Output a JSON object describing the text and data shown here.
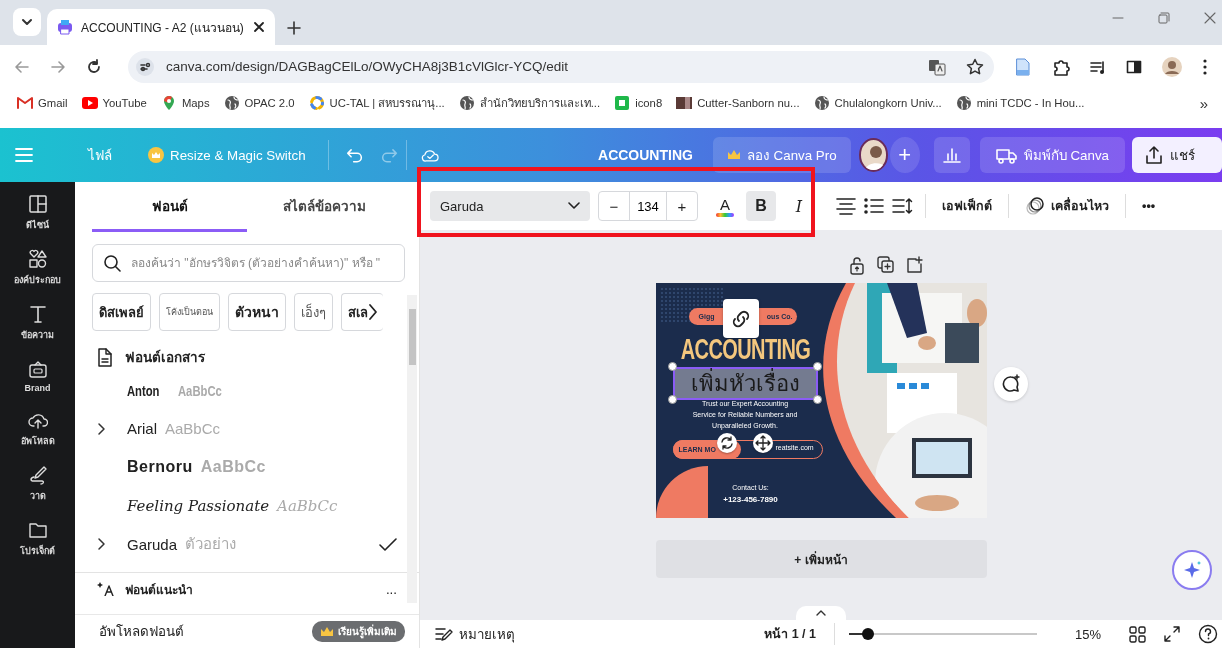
{
  "browser": {
    "tabs": [
      {
        "title": "ACCOUNTING - A2 (แนวนอน)",
        "selected": true
      }
    ],
    "url": "canva.com/design/DAGBagCElLo/OWyCHA8j3B1cVlGlcr-YCQ/edit",
    "bookmarks": [
      {
        "label": "Gmail",
        "kind": "mail"
      },
      {
        "label": "YouTube",
        "kind": "video"
      },
      {
        "label": "Maps",
        "kind": "pin"
      },
      {
        "label": "OPAC 2.0",
        "kind": "globe"
      },
      {
        "label": "UC-TAL | สหบรรณานุ...",
        "kind": "ring"
      },
      {
        "label": "สำนักวิทยบริการและเท...",
        "kind": "globe"
      },
      {
        "label": "icon8",
        "kind": "square"
      },
      {
        "label": "Cutter-Sanborn nu...",
        "kind": "thumb"
      },
      {
        "label": "Chulalongkorn Univ...",
        "kind": "globe"
      },
      {
        "label": "mini TCDC - In Hou...",
        "kind": "globe"
      }
    ],
    "more": "»"
  },
  "header": {
    "file": "ไฟล์",
    "resize": "Resize & Magic Switch",
    "title": "ACCOUNTING",
    "pro": "ลอง Canva Pro",
    "invite": "+",
    "print": "พิมพ์กับ Canva",
    "share": "แชร์"
  },
  "rail": [
    {
      "label": "ดีไซน์",
      "kind": "layout"
    },
    {
      "label": "องค์ประกอบ",
      "kind": "shapes"
    },
    {
      "label": "ข้อความ",
      "kind": "text"
    },
    {
      "label": "Brand",
      "kind": "brand"
    },
    {
      "label": "อัพโหลด",
      "kind": "upload"
    },
    {
      "label": "วาด",
      "kind": "draw"
    },
    {
      "label": "โปรเจ็กต์",
      "kind": "folder"
    }
  ],
  "panel": {
    "tabs": [
      {
        "label": "ฟอนต์",
        "selected": true
      },
      {
        "label": "สไตล์ข้อความ",
        "selected": false
      }
    ],
    "search_placeholder": "ลองค้นว่า \"อักษรวิจิตร (ตัวอย่างคำค้นหา)\" หรือ \"",
    "chips": [
      {
        "label": "ดิสเพลย์",
        "kind": "display"
      },
      {
        "label": "โค้งเป็นตอน",
        "kind": "thin"
      },
      {
        "label": "ตัวหนา",
        "kind": "bold"
      },
      {
        "label": "เอ็งๆ",
        "kind": "light"
      },
      {
        "label": "สเล",
        "kind": "plain"
      }
    ],
    "section": "ฟอนต์เอกสาร",
    "fonts": [
      {
        "name": "Anton",
        "sample": "AaBbCc",
        "kind": "condensed",
        "expandable": false,
        "checked": false
      },
      {
        "name": "Arial",
        "sample": "AaBbCc",
        "kind": "sans",
        "expandable": true,
        "checked": false
      },
      {
        "name": "Bernoru",
        "sample": "AaBbCc",
        "kind": "heavy",
        "expandable": false,
        "checked": false
      },
      {
        "name": "Feeling Passionate",
        "sample": "AaBbCc",
        "kind": "script",
        "expandable": false,
        "checked": false
      },
      {
        "name": "Garuda",
        "sample": "ตัวอย่าง",
        "kind": "sans",
        "expandable": true,
        "checked": true
      }
    ],
    "recommended": "ฟอนต์แนะนำ",
    "recommended_more": "...",
    "upload": "อัพโหลดฟอนต์",
    "learn": "เรียนรู้เพิ่มเติม"
  },
  "toolbar": {
    "font": "Garuda",
    "minus": "−",
    "size": "134",
    "plus": "+",
    "color_label": "A",
    "bold": {
      "label": "B",
      "selected": true
    },
    "italic": {
      "label": "I",
      "selected": false
    },
    "effects": "เอฟเฟ็กต์",
    "animate": "เคลื่อนไหว",
    "more": "•••"
  },
  "design": {
    "company_left": "Gigg",
    "company_right": "ous Co.",
    "heading": "ACCOUNTING",
    "selected_text": "เพิ่มหัวเรื่อง",
    "tagline": [
      "Trust our Expert Accounting",
      "Service for Reliable Numbers and",
      "Unparalleled Growth."
    ],
    "button": "LEARN MO",
    "website": "reatsite.com",
    "contact": "Contact Us:",
    "phone": "+123-456-7890"
  },
  "add_page": "+ เพิ่มหน้า",
  "footer": {
    "notes": "หมายเหตุ",
    "page": "หน้า 1 / 1",
    "zoom": {
      "level": 0.1
    },
    "zoom_reading": "15%"
  }
}
